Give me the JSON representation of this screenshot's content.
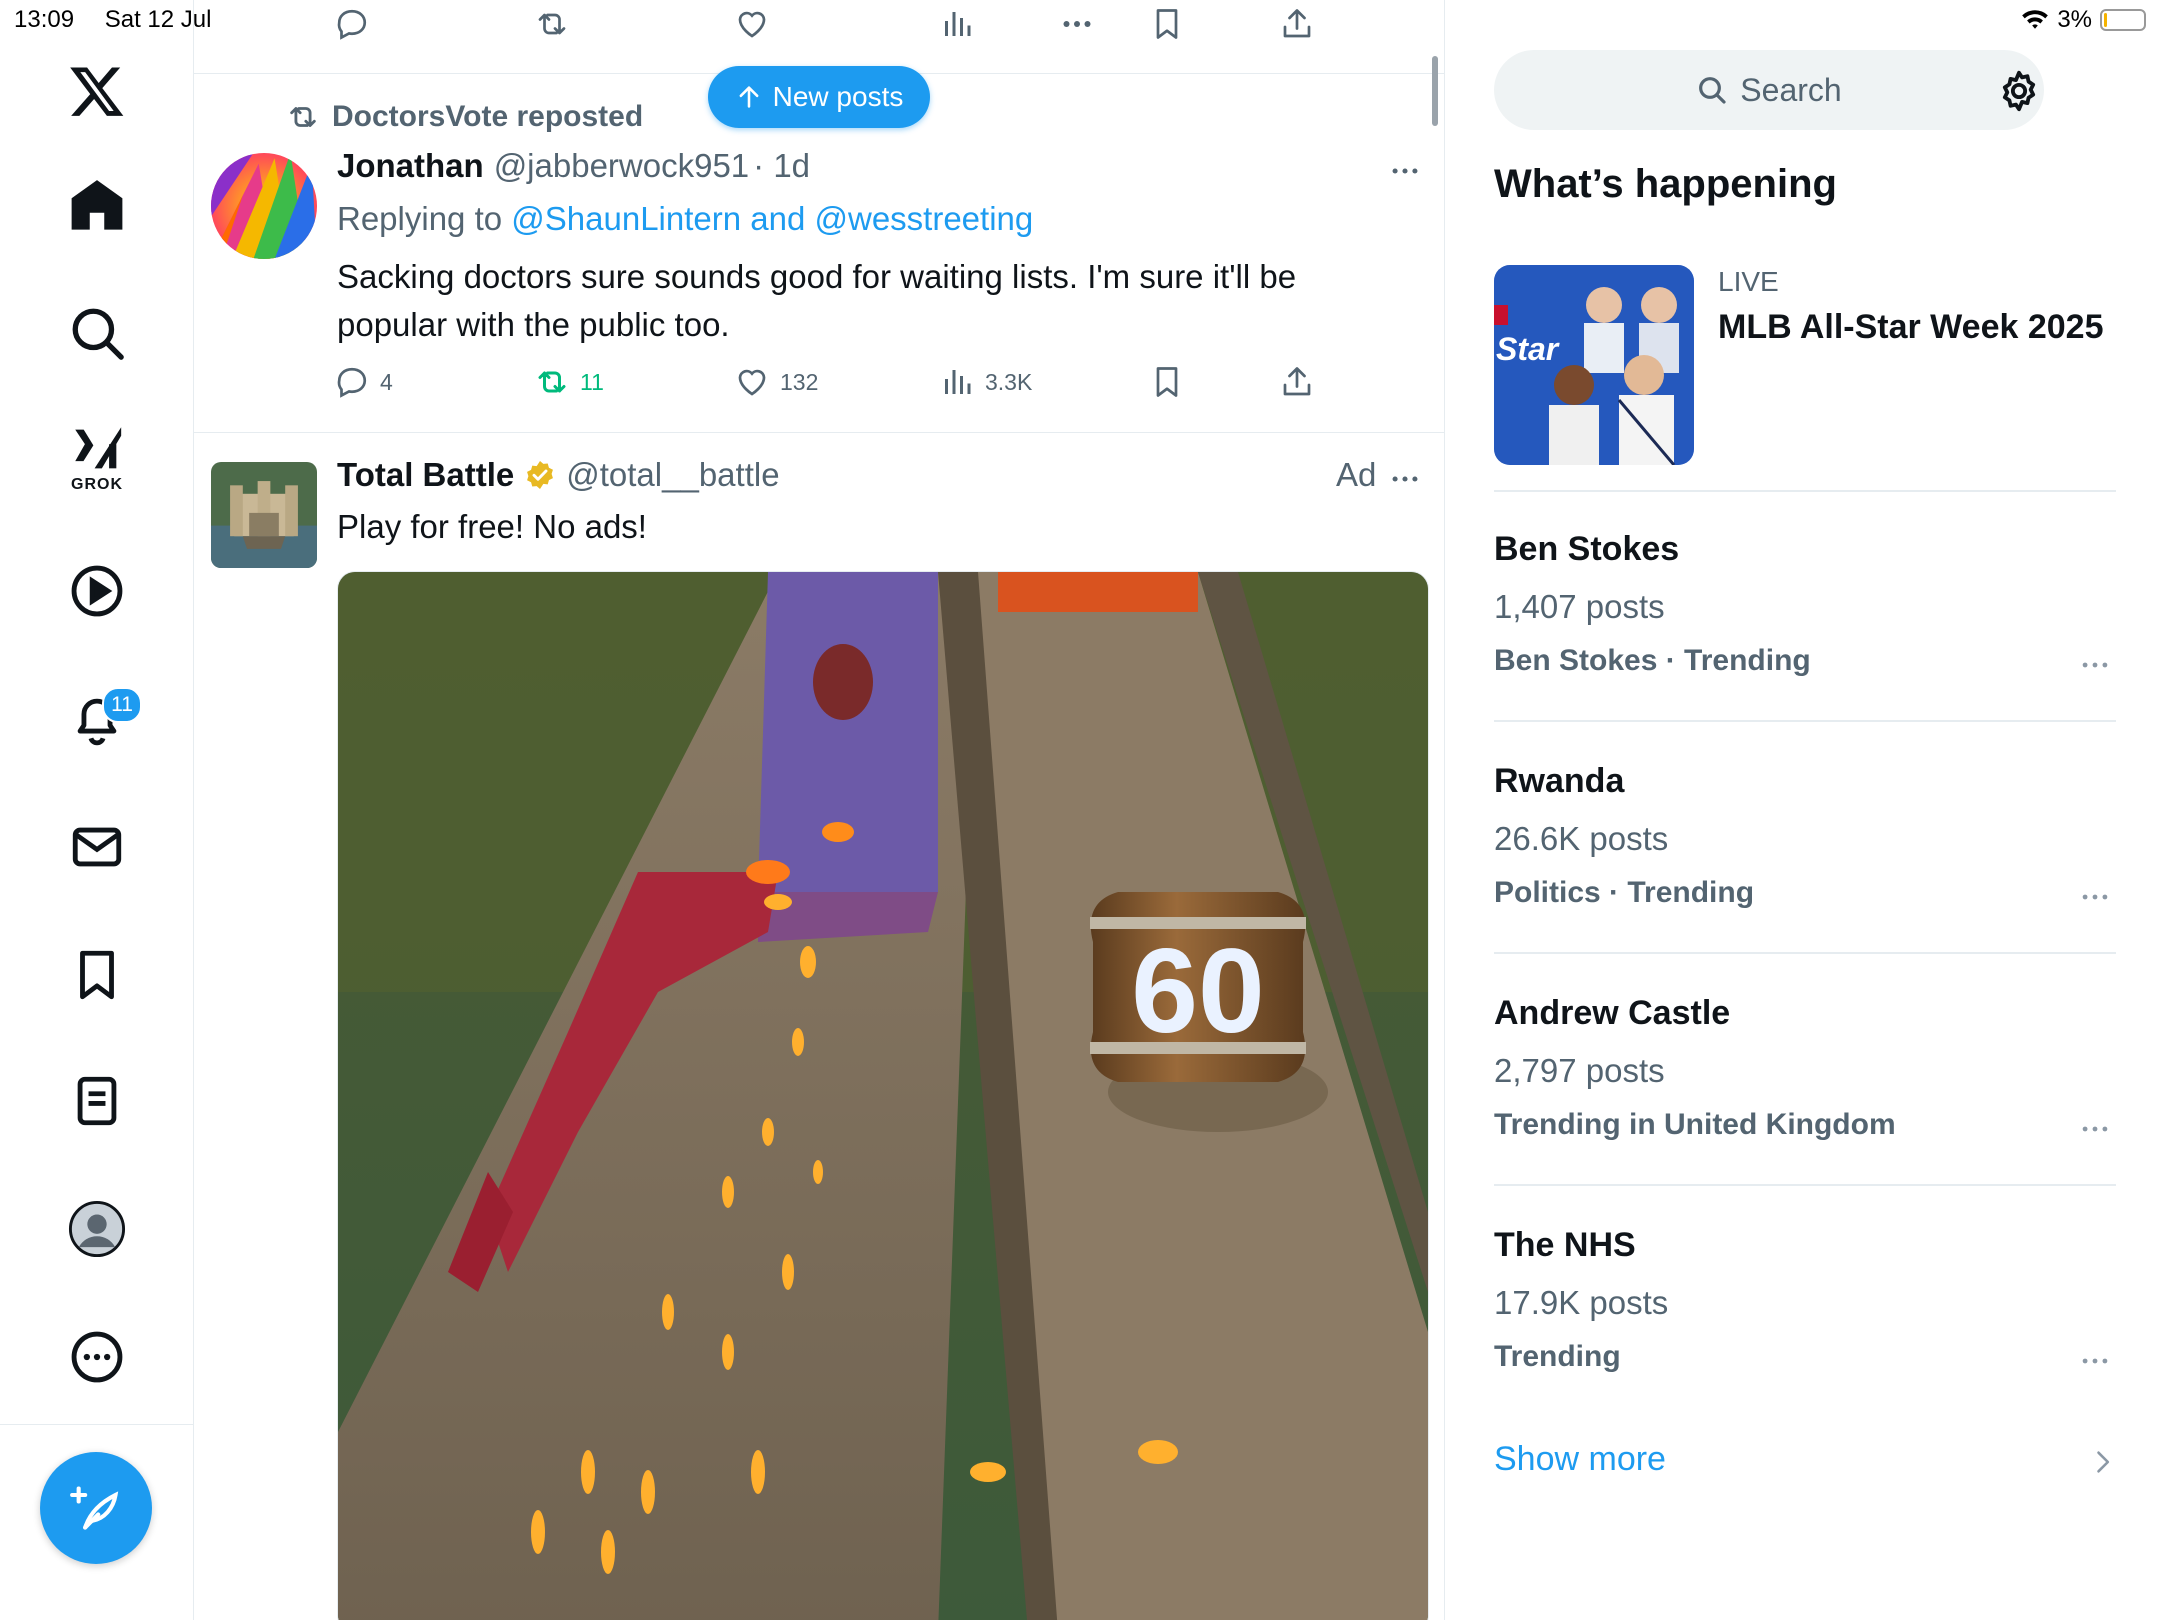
{
  "status_bar": {
    "time": "13:09",
    "date": "Sat 12 Jul",
    "battery": "3%"
  },
  "nav": {
    "grok_label": "GROK",
    "notifications_badge": "11",
    "items": [
      "home",
      "explore",
      "grok",
      "video",
      "notifications",
      "messages",
      "bookmarks",
      "lists",
      "profile",
      "more"
    ]
  },
  "new_posts_label": "New posts",
  "post1": {
    "repost_by": "DoctorsVote reposted",
    "name": "Jonathan",
    "handle": "@jabberwock951",
    "time": "· 1d",
    "replying_prefix": "Replying to ",
    "replying_to": "@ShaunLintern and @wesstreeting",
    "text": "Sacking doctors sure sounds good for waiting lists. I'm sure it'll be popular with the public too.",
    "replies": "4",
    "reposts": "11",
    "likes": "132",
    "views": "3.3K"
  },
  "post2": {
    "name": "Total Battle",
    "handle": "@total__battle",
    "ad_label": "Ad",
    "text": "Play for free! No ads!",
    "barrel_number": "60"
  },
  "sidebar": {
    "search_placeholder": "Search",
    "section_title": "What’s happening",
    "live": {
      "label": "LIVE",
      "title": "MLB All-Star Week 2025"
    },
    "trends": [
      {
        "title": "Ben Stokes",
        "posts": "1,407 posts",
        "context": "Ben Stokes · Trending"
      },
      {
        "title": "Rwanda",
        "posts": "26.6K posts",
        "context": "Politics · Trending"
      },
      {
        "title": "Andrew Castle",
        "posts": "2,797 posts",
        "context": "Trending in United Kingdom"
      },
      {
        "title": "The NHS",
        "posts": "17.9K posts",
        "context": "Trending"
      }
    ],
    "show_more": "Show more"
  },
  "colors": {
    "accent": "#1d9bf0",
    "repost_green": "#00ba7c",
    "secondary_text": "#536471",
    "verified_gold": "#e8b923"
  }
}
